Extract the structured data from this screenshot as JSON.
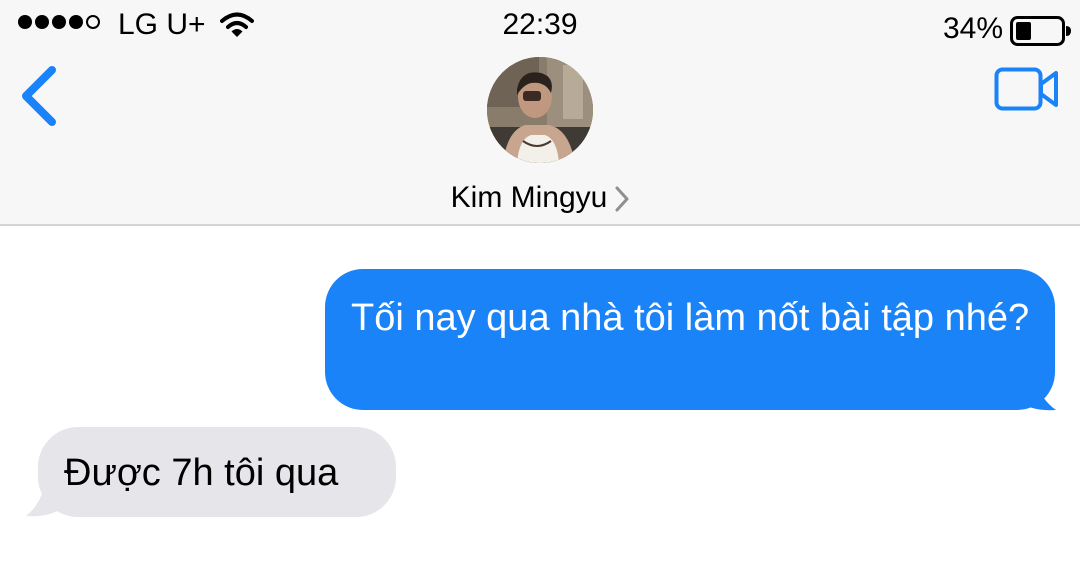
{
  "status_bar": {
    "carrier": "LG U+",
    "time": "22:39",
    "battery": "34%",
    "signal_bars": 4,
    "signal_max": 5,
    "battery_level": 0.34
  },
  "nav": {
    "back_icon": "chevron-left-icon",
    "video_icon": "video-camera-icon",
    "contact_name": "Kim Mingyu",
    "accent_color": "#1b83f8"
  },
  "messages": [
    {
      "direction": "outgoing",
      "text": "Tối nay qua nhà tôi làm nốt bài tập nhé?",
      "color": "#1b83f8"
    },
    {
      "direction": "incoming",
      "text": "Được 7h tôi qua",
      "color": "#e5e5ea"
    }
  ]
}
